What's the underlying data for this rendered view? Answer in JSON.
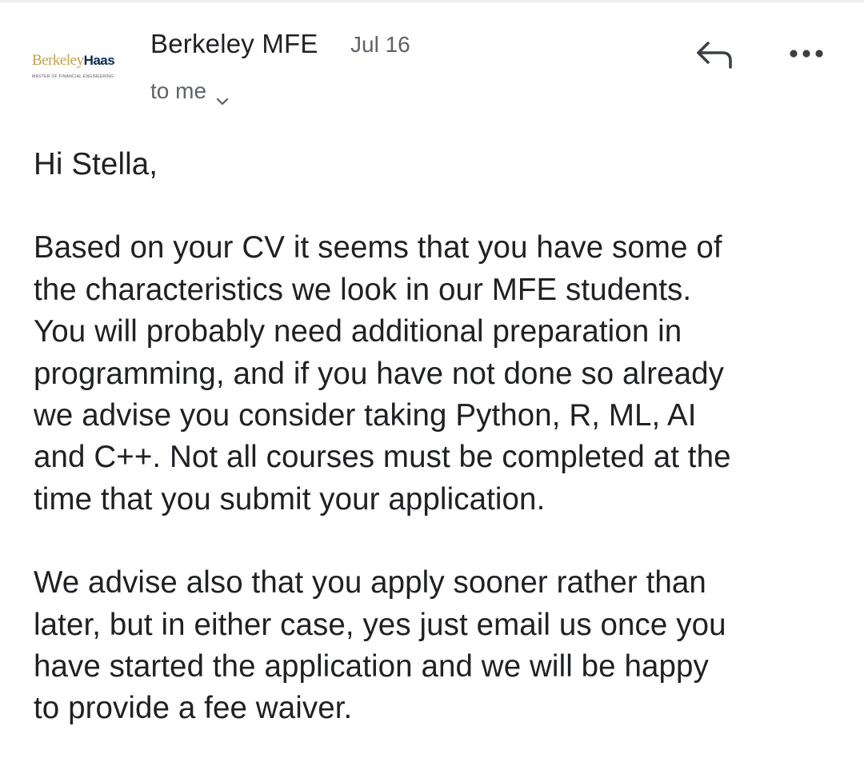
{
  "sender": {
    "name": "Berkeley MFE",
    "date": "Jul 16",
    "recipient_label": "to me",
    "logo": {
      "brand_primary": "Berkeley",
      "brand_secondary": "Haas",
      "subtitle": "MASTER OF FINANCIAL ENGINEERING"
    }
  },
  "icons": {
    "reply": "reply-arrow-icon",
    "more": "more-horizontal-icon",
    "chevron": "chevron-down-icon"
  },
  "message": {
    "greeting": "Hi Stella,",
    "paragraphs": [
      "Based on your CV it seems that you have some of\nthe characteristics we look in our MFE students.\nYou will probably need additional preparation in\nprogramming, and if you have not done so already\nwe advise you consider taking Python, R, ML, AI\nand C++. Not all courses must be completed at the\ntime that you submit your application.",
      "We advise also that you apply sooner rather than\nlater, but in either case, yes just email us once you\nhave started the application and we will be happy\nto provide a fee waiver."
    ]
  },
  "colors": {
    "logo_gold": "#c4a24a",
    "logo_navy": "#0b2a57",
    "text": "#202124",
    "secondary_text": "#5f6368"
  }
}
